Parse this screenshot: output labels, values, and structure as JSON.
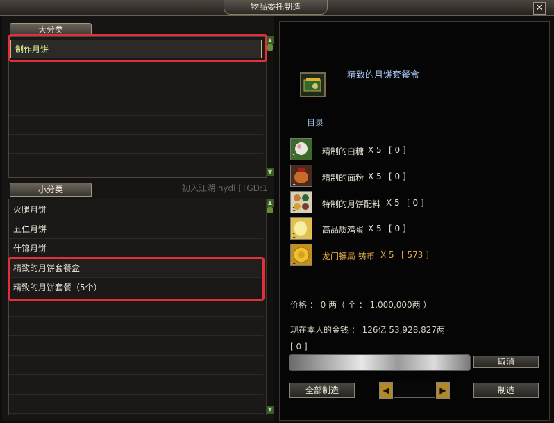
{
  "window": {
    "title": "物品委托制造",
    "close_label": "✕"
  },
  "left": {
    "major_tab": "大分类",
    "major_items": [
      "制作月饼"
    ],
    "minor_tab": "小分类",
    "minor_items": [
      "火腿月饼",
      "五仁月饼",
      "什锦月饼",
      "精致的月饼套餐盒",
      "精致的月饼套餐（5个）"
    ],
    "background_text": "初入江湖   nydl [TGD:1"
  },
  "right": {
    "item_name": "精致的月饼套餐盒",
    "catalog_label": "目录",
    "materials": [
      {
        "name": "精制的白糖",
        "qty": "X 5",
        "have": "[ 0 ]",
        "icon": "sugar-icon",
        "highlight": false
      },
      {
        "name": "精制的面粉",
        "qty": "X 5",
        "have": "[ 0 ]",
        "icon": "flour-icon",
        "highlight": false
      },
      {
        "name": "特制的月饼配料",
        "qty": "X 5",
        "have": "[ 0 ]",
        "icon": "ingredients-icon",
        "highlight": false
      },
      {
        "name": "高品质鸡蛋",
        "qty": "X 5",
        "have": "[ 0 ]",
        "icon": "egg-icon",
        "highlight": false
      },
      {
        "name": "龙门镖局 铸币",
        "qty": "X 5",
        "have": "[ 573 ]",
        "icon": "coin-icon",
        "highlight": true
      }
    ],
    "price_text": "价格 ： 0 两（ 个 ： 1,000,000两 ）",
    "money_text": "现在本人的金钱 ： 126亿 53,928,827两",
    "progress_label": "[ 0 ]",
    "cancel_label": "取消",
    "make_all_label": "全部制造",
    "make_label": "制造"
  }
}
